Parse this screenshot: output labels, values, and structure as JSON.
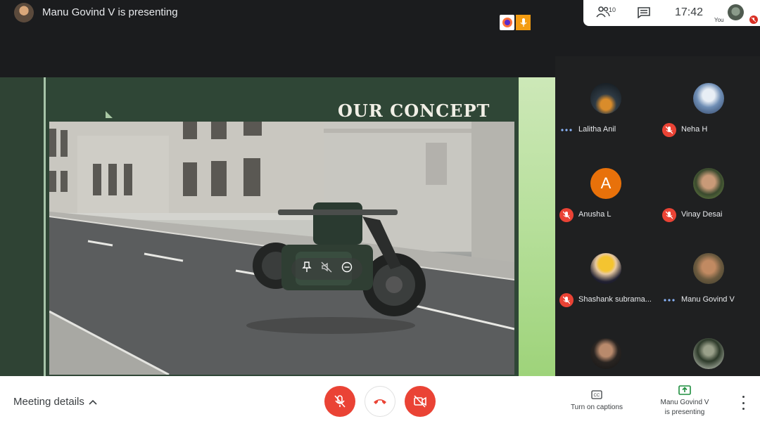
{
  "window": {
    "presenting_text": "Manu Govind V is presenting"
  },
  "top_right": {
    "people_count": "10",
    "clock": "17:42",
    "you_label": "You"
  },
  "slide": {
    "title": "OUR CONCEPT"
  },
  "participants": [
    {
      "name": "Lalitha Anil",
      "status": "speaking",
      "avatar": "photo"
    },
    {
      "name": "Neha H",
      "status": "muted",
      "avatar": "photo"
    },
    {
      "name": "Anusha L",
      "status": "muted",
      "avatar": "letter",
      "initial": "A"
    },
    {
      "name": "Vinay Desai",
      "status": "muted",
      "avatar": "photo"
    },
    {
      "name": "Shashank subrama...",
      "status": "muted",
      "avatar": "photo"
    },
    {
      "name": "Manu Govind V",
      "status": "speaking",
      "avatar": "photo"
    },
    {
      "name": "",
      "status": "none",
      "avatar": "photo"
    },
    {
      "name": "",
      "status": "none",
      "avatar": "photo"
    }
  ],
  "bottom": {
    "meeting_details": "Meeting details",
    "captions_label": "Turn on captions",
    "presenting_line1": "Manu Govind V",
    "presenting_line2": "is presenting"
  },
  "colors": {
    "end_call_red": "#ea4335",
    "accent_green": "#1e8e3e"
  }
}
